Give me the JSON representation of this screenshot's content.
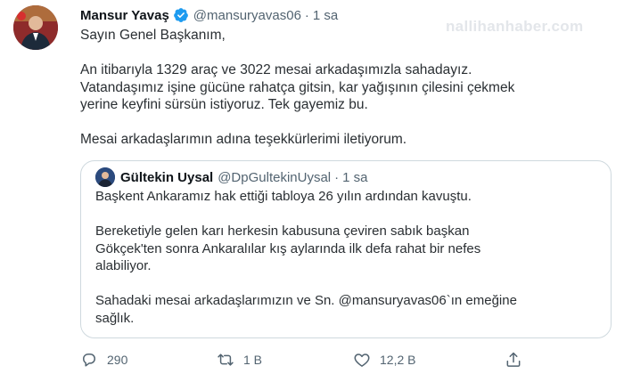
{
  "tweet": {
    "display_name": "Mansur Yavaş",
    "handle": "@mansuryavas06",
    "separator": "·",
    "time": "1 sa",
    "lines": [
      "Sayın Genel Başkanım,",
      "",
      "An itibarıyla 1329 araç ve 3022 mesai arkadaşımızla sahadayız.",
      "Vatandaşımız işine gücüne rahatça gitsin, kar yağışının çilesini çekmek",
      "yerine keyfini sürsün istiyoruz. Tek gayemiz bu.",
      "",
      "Mesai arkadaşlarımın adına teşekkürlerimi iletiyorum."
    ]
  },
  "watermark": "nallihanhaber.com",
  "quote": {
    "display_name": "Gültekin Uysal",
    "handle": "@DpGultekinUysal",
    "separator": "·",
    "time": "1 sa",
    "lines": [
      "Başkent Ankaramız hak ettiği tabloya 26 yılın ardından kavuştu.",
      "",
      "Bereketiyle gelen karı herkesin kabusuna çeviren sabık başkan",
      "Gökçek'ten sonra Ankaralılar kış aylarında ilk defa rahat bir nefes",
      "alabiliyor.",
      "",
      "Sahadaki mesai arkadaşlarımızın ve Sn. @mansuryavas06`ın emeğine",
      "sağlık."
    ]
  },
  "actions": {
    "reply_count": "290",
    "retweet_count": "1 B",
    "like_count": "12,2 B"
  },
  "icons": {
    "verified": "verified-badge-icon",
    "reply": "reply-icon",
    "retweet": "retweet-icon",
    "like": "heart-icon",
    "share": "share-icon"
  },
  "colors": {
    "verified": "#1d9bf0",
    "secondary_text": "#536471",
    "border": "#cfd9de"
  }
}
